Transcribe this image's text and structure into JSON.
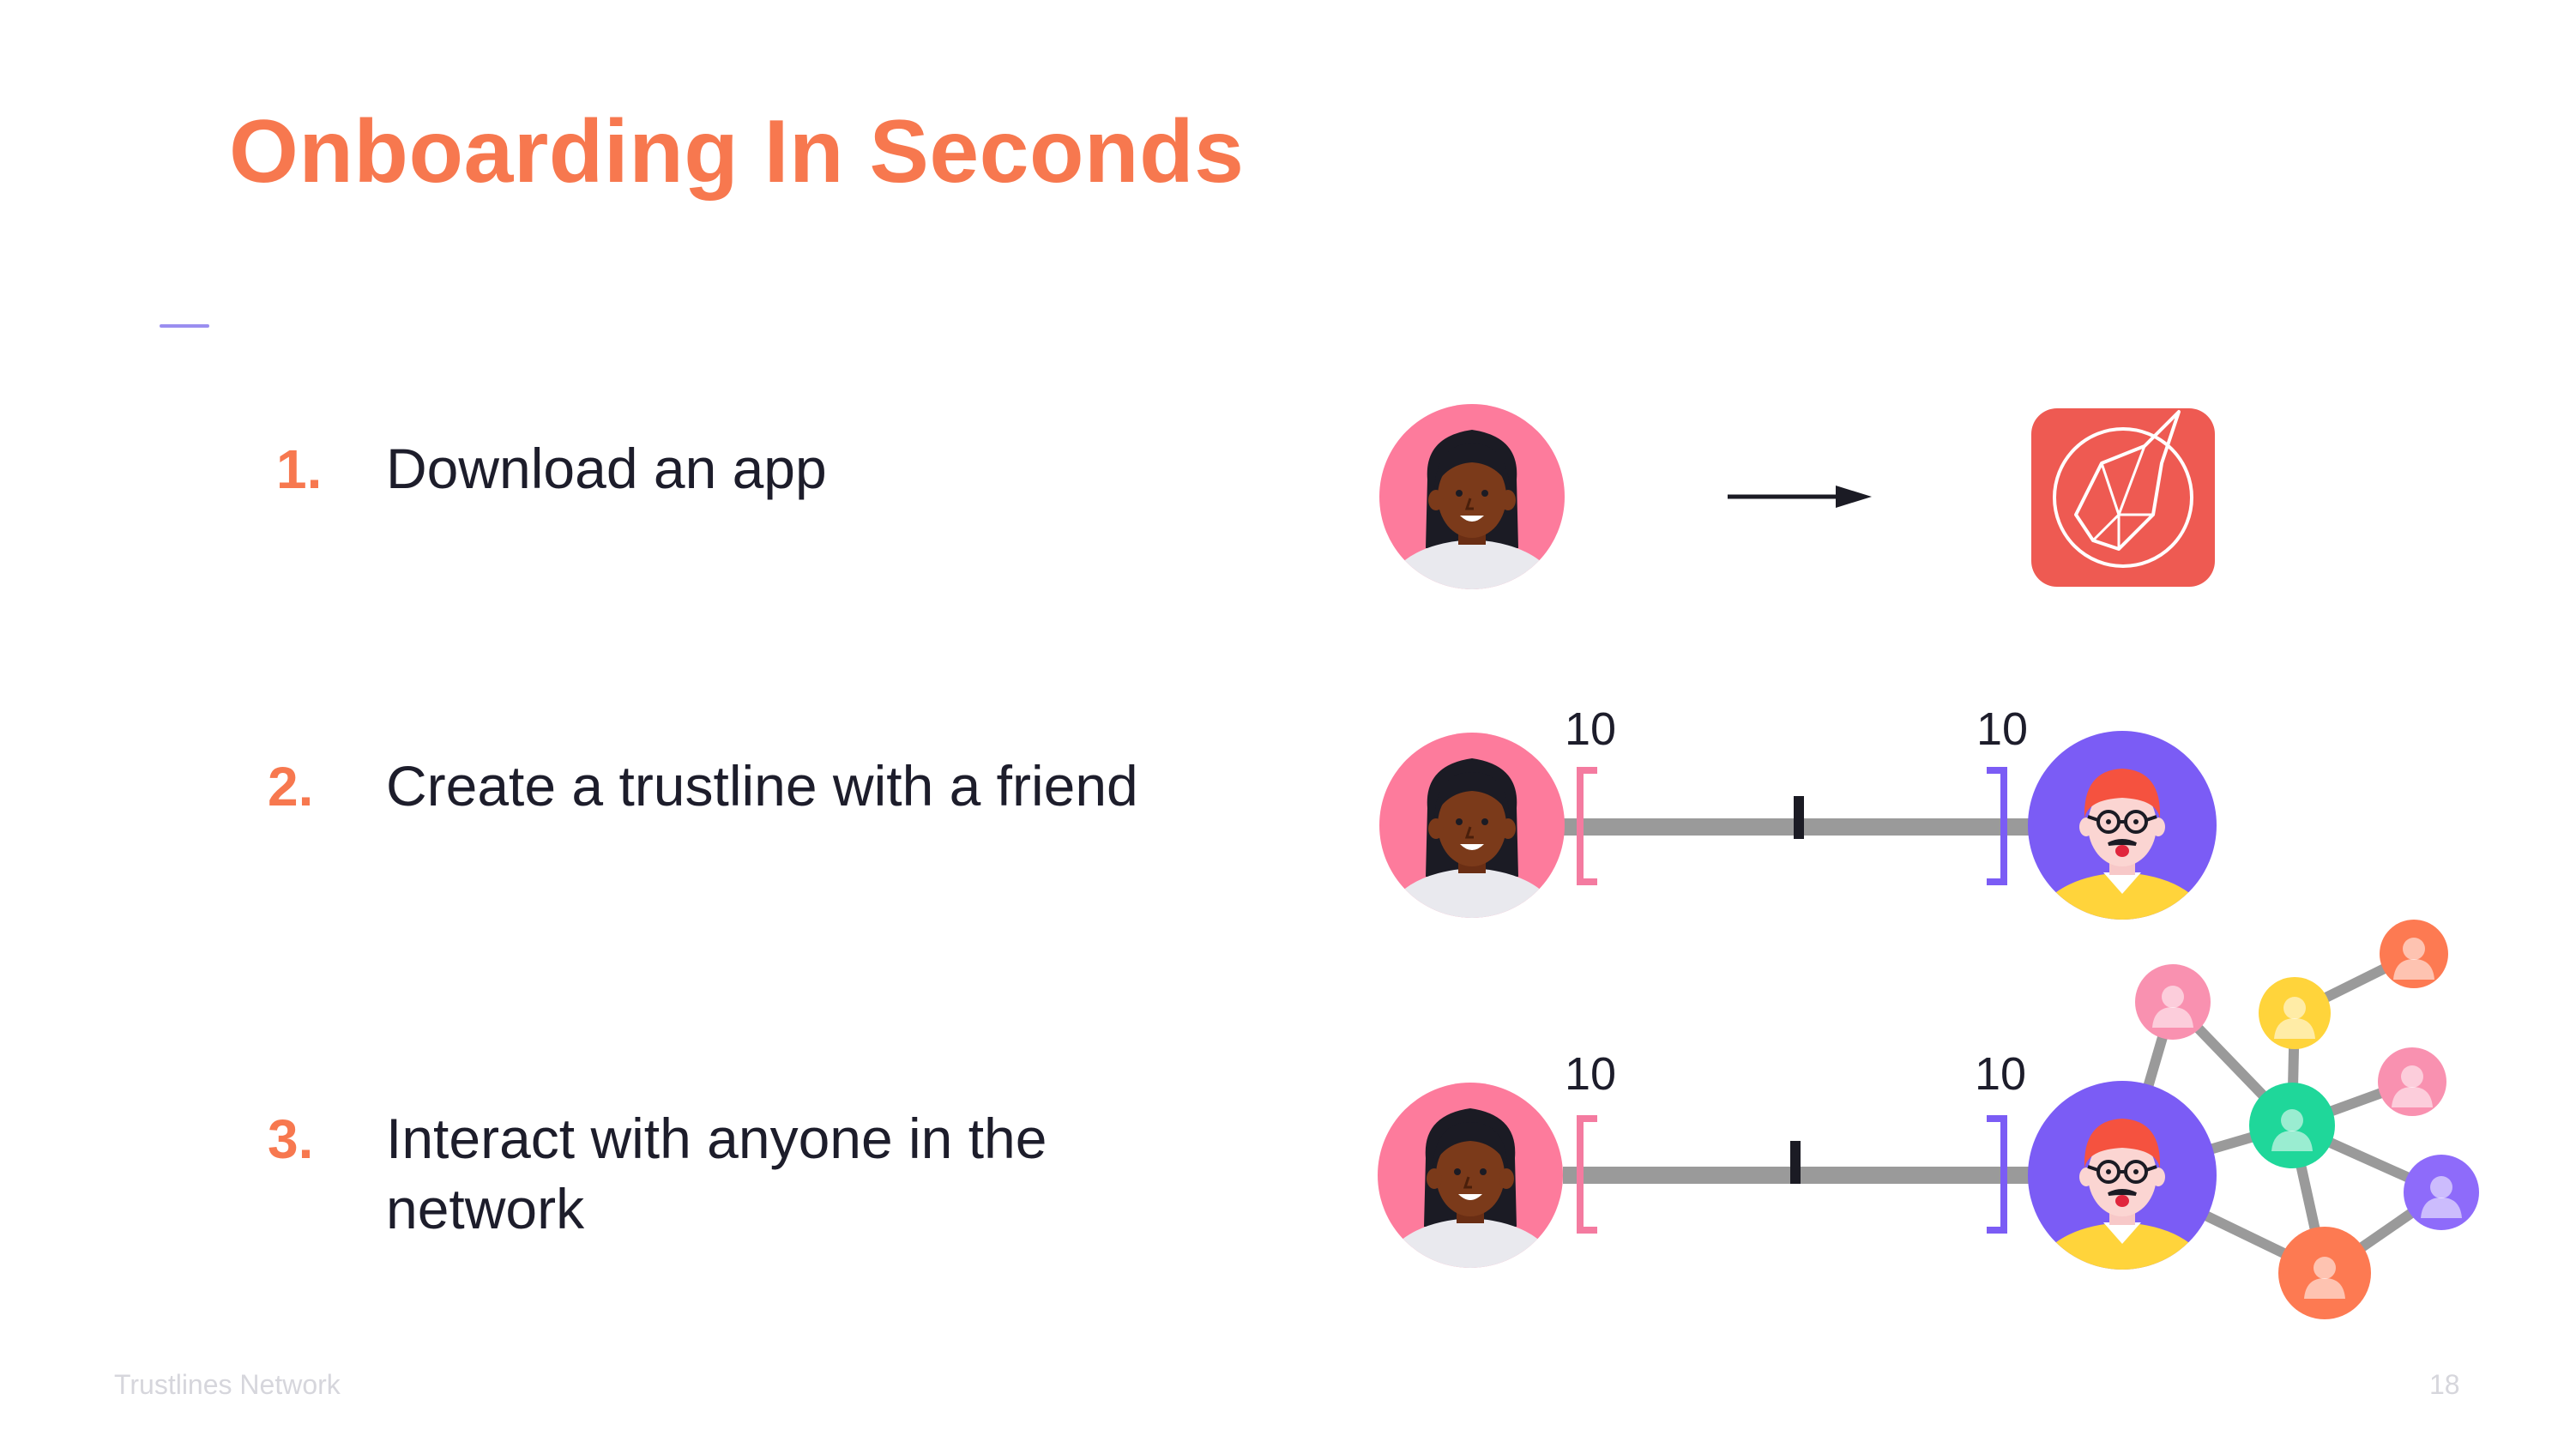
{
  "slide": {
    "title": "Onboarding In Seconds",
    "steps": [
      {
        "number": "1.",
        "lines": [
          "Download an app"
        ]
      },
      {
        "number": "2.",
        "lines": [
          "Create a trustline with a friend"
        ]
      },
      {
        "number": "3.",
        "lines": [
          "Interact with anyone in the",
          "network"
        ]
      }
    ],
    "footer": {
      "brand": "Trustlines Network",
      "page_number": "18"
    }
  },
  "diagram": {
    "trustline_row2": {
      "left_limit": "10",
      "right_limit": "10"
    },
    "trustline_row3": {
      "left_limit": "10",
      "right_limit": "10"
    }
  },
  "colors": {
    "accent_orange": "#f7784f",
    "accent_purple": "#7b5cf5",
    "trustline_gray": "#9a9a9a",
    "bracket_pink": "#f47ba0",
    "bracket_purple": "#7b5cf5",
    "app_icon_red": "#ee5a52",
    "avatar_pink_bg": "#fd7b9c",
    "avatar_purple_bg": "#7b5cf5"
  },
  "icons": [
    "woman-avatar-icon",
    "man-avatar-icon",
    "arrow-right-icon",
    "trustlines-unicorn-app-icon",
    "network-member-icon"
  ]
}
